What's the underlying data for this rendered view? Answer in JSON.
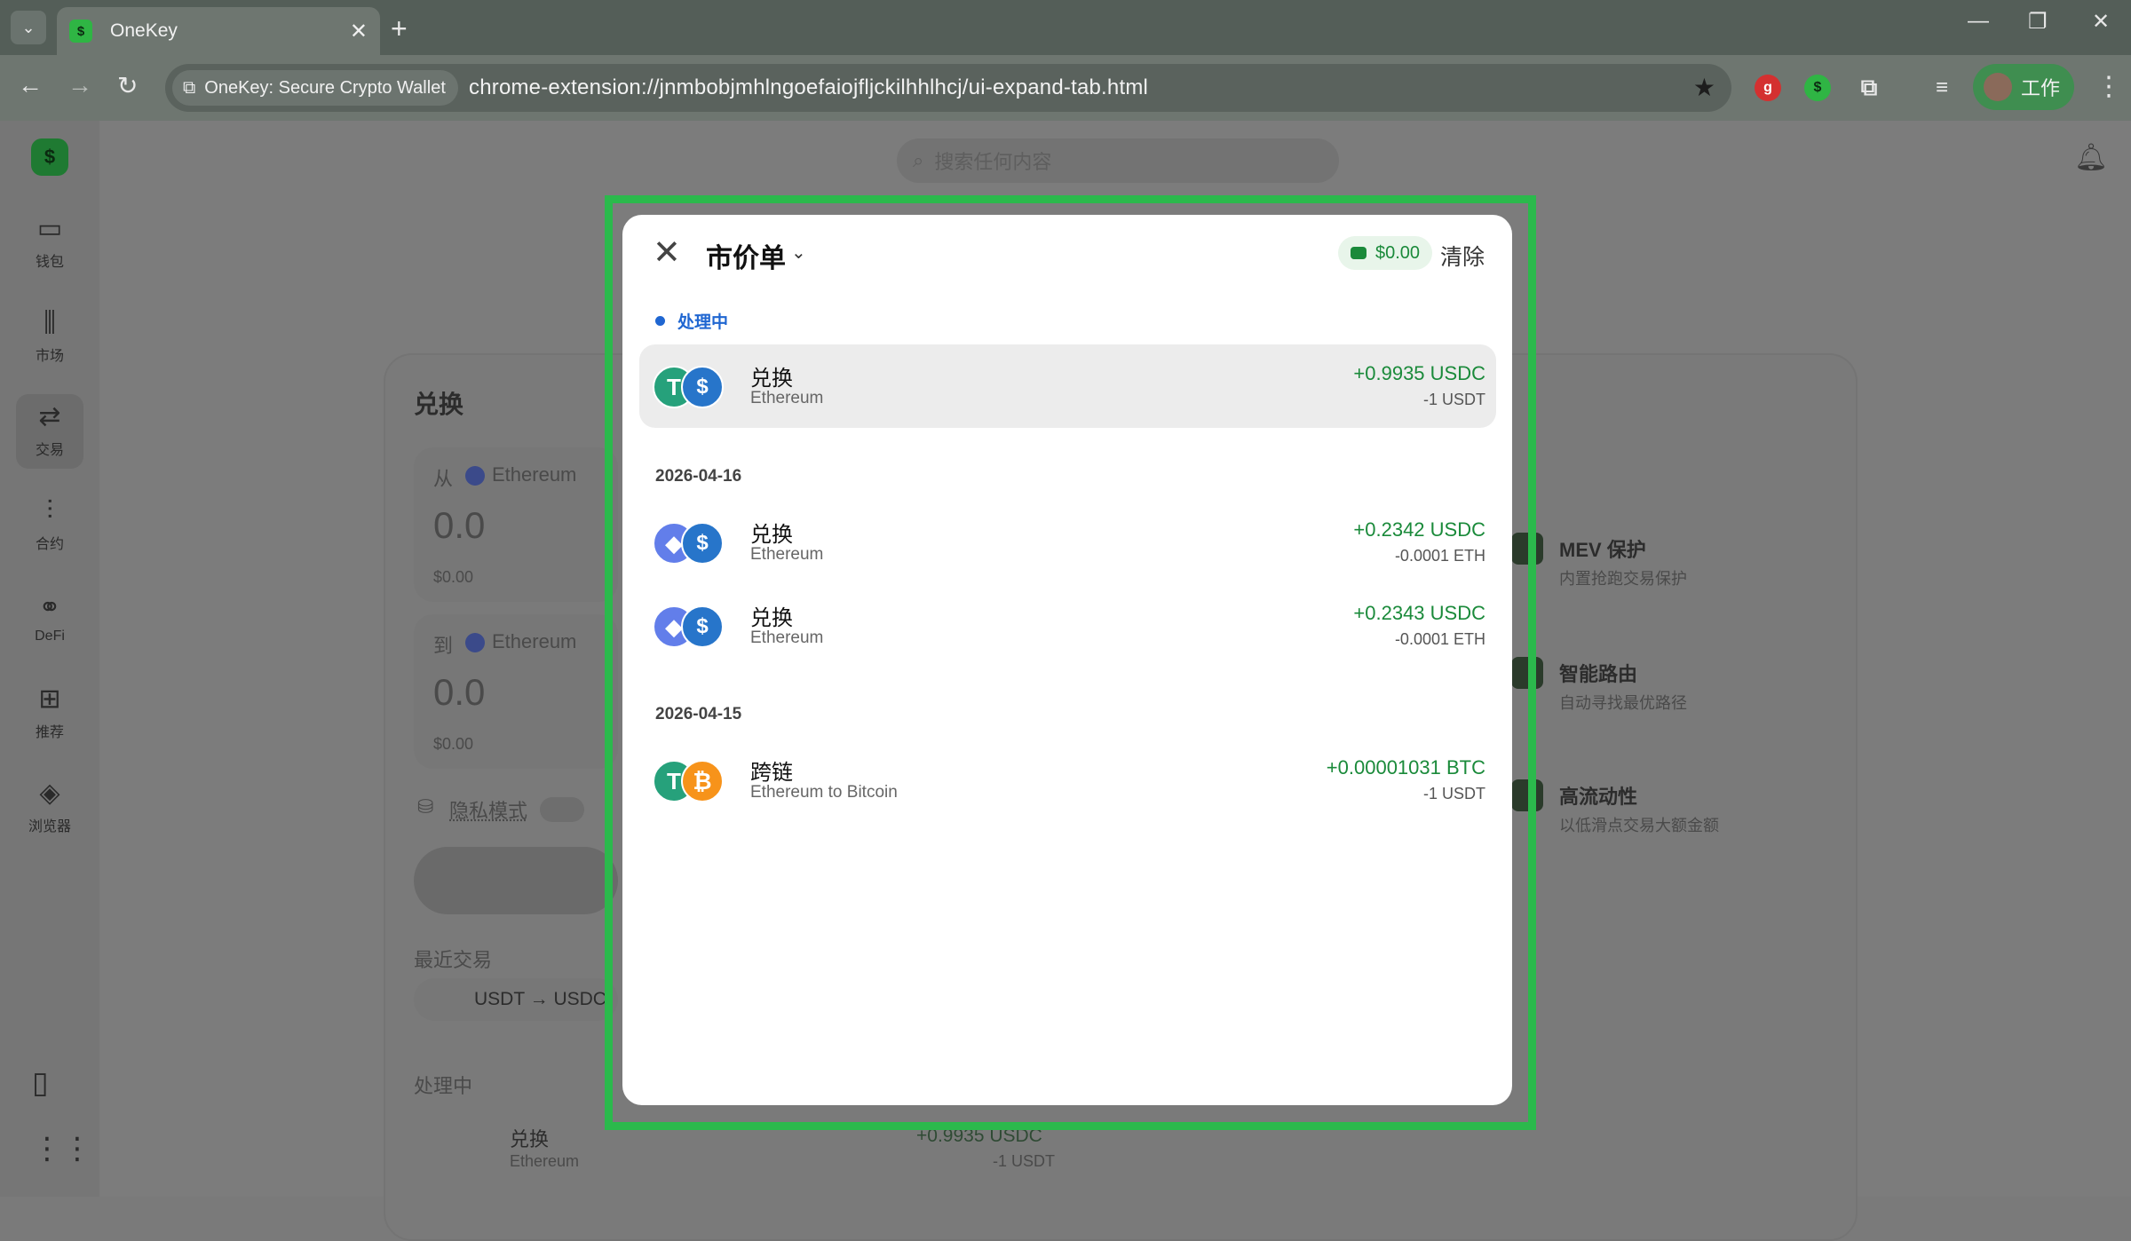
{
  "browser": {
    "tab_title": "OneKey",
    "site_chip": "OneKey: Secure Crypto Wallet",
    "url": "chrome-extension://jnmbobjmhlngoefaiojfljckilhhlhcj/ui-expand-tab.html",
    "profile_label": "工作"
  },
  "sidebar": {
    "items": [
      {
        "label": "钱包",
        "icon": "wallet-icon"
      },
      {
        "label": "市场",
        "icon": "market-icon"
      },
      {
        "label": "交易",
        "icon": "swap-icon"
      },
      {
        "label": "合约",
        "icon": "perps-icon"
      },
      {
        "label": "DeFi",
        "icon": "defi-icon"
      },
      {
        "label": "推荐",
        "icon": "gift-icon"
      },
      {
        "label": "浏览器",
        "icon": "compass-icon"
      }
    ]
  },
  "header": {
    "search_placeholder": "搜索任何内容"
  },
  "swap": {
    "title": "兑换",
    "from_label": "从",
    "from_chain": "Ethereum",
    "from_amount": "0.0",
    "from_value": "$0.00",
    "to_label": "到",
    "to_chain": "Ethereum",
    "to_amount": "0.0",
    "to_value": "$0.00",
    "privacy_label": "隐私模式",
    "recent_label": "最近交易",
    "recent_pair": "USDT → USDC",
    "processing_label": "处理中",
    "bg_tx_title": "兑换",
    "bg_tx_sub": "Ethereum",
    "bg_tx_amount": "+0.9935 USDC",
    "bg_tx_amount2": "-1 USDT",
    "features": [
      {
        "title": "MEV 保护",
        "desc": "内置抢跑交易保护"
      },
      {
        "title": "智能路由",
        "desc": "自动寻找最优路径"
      },
      {
        "title": "高流动性",
        "desc": "以低滑点交易大额金额"
      }
    ]
  },
  "modal": {
    "title": "市价单",
    "gas_value": "$0.00",
    "clear_label": "清除",
    "processing_label": "处理中",
    "processing": [
      {
        "title": "兑换",
        "network": "Ethereum",
        "amount_in": "+0.9935 USDC",
        "amount_out": "-1 USDT",
        "token_a": "usdt",
        "token_b": "usdc"
      }
    ],
    "groups": [
      {
        "date": "2026-04-16",
        "rows": [
          {
            "title": "兑换",
            "network": "Ethereum",
            "amount_in": "+0.2342 USDC",
            "amount_out": "-0.0001 ETH",
            "token_a": "eth",
            "token_b": "usdc"
          },
          {
            "title": "兑换",
            "network": "Ethereum",
            "amount_in": "+0.2343 USDC",
            "amount_out": "-0.0001 ETH",
            "token_a": "eth",
            "token_b": "usdc"
          }
        ]
      },
      {
        "date": "2026-04-15",
        "rows": [
          {
            "title": "跨链",
            "network": "Ethereum to Bitcoin",
            "amount_in": "+0.00001031 BTC",
            "amount_out": "-1 USDT",
            "token_a": "usdt",
            "token_b": "btc"
          }
        ]
      }
    ]
  },
  "colors": {
    "accent_green": "#2bb94c",
    "positive": "#1a8a3a",
    "processing_blue": "#1f66d1"
  }
}
